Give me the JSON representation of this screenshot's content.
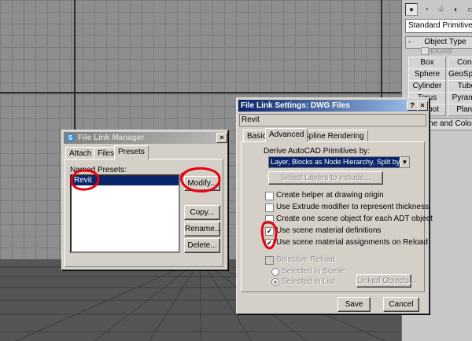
{
  "command_panel": {
    "dropdown_value": "Standard Primitives",
    "rollout_object_type": "Object Type",
    "autogrid_label": "AutoGrid",
    "buttons": [
      "Box",
      "Cone",
      "Sphere",
      "GeoSphere",
      "Cylinder",
      "Tube",
      "Torus",
      "Pyramid",
      "Teapot",
      "Plane"
    ],
    "rollout_name_color": "Name and Color"
  },
  "file_link_manager": {
    "title": "File Link Manager",
    "tabs": [
      "Attach",
      "Files",
      "Presets"
    ],
    "named_presets_label": "Named Presets:",
    "presets": [
      "Revit"
    ],
    "buttons": {
      "modify": "Modify...",
      "copy": "Copy...",
      "rename": "Rename...",
      "delete": "Delete..."
    },
    "close_glyph": "×"
  },
  "settings_dialog": {
    "title": "File Link Settings: DWG Files",
    "help_glyph": "?",
    "close_glyph": "×",
    "preset_name": "Revit",
    "tabs": [
      "Basic",
      "Advanced",
      "Spline Rendering"
    ],
    "derive_label": "Derive AutoCAD Primitives by:",
    "derive_value": "Layer, Blocks as Node Hierarchy, Split by Material",
    "select_layers_button": "Select Layers to include...",
    "options": [
      {
        "label": "Create helper at drawing origin",
        "checked": false
      },
      {
        "label": "Use Extrude modifier to represent thickness",
        "checked": false
      },
      {
        "label": "Create one scene object for each ADT object",
        "checked": false
      },
      {
        "label": "Use scene material definitions",
        "checked": true
      },
      {
        "label": "Use scene material assignments on Reload",
        "checked": true
      }
    ],
    "selective_reload_label": "Selective Reload",
    "radio_selected_in_scene": "Selected in Scene",
    "radio_selected_in_list": "Selected in List",
    "linked_objects_button": "Linked Objects...",
    "save_button": "Save",
    "cancel_button": "Cancel"
  },
  "colors": {
    "annotation_red": "#e8000e",
    "title_active": "#0a246a",
    "selection": "#0a246a"
  }
}
